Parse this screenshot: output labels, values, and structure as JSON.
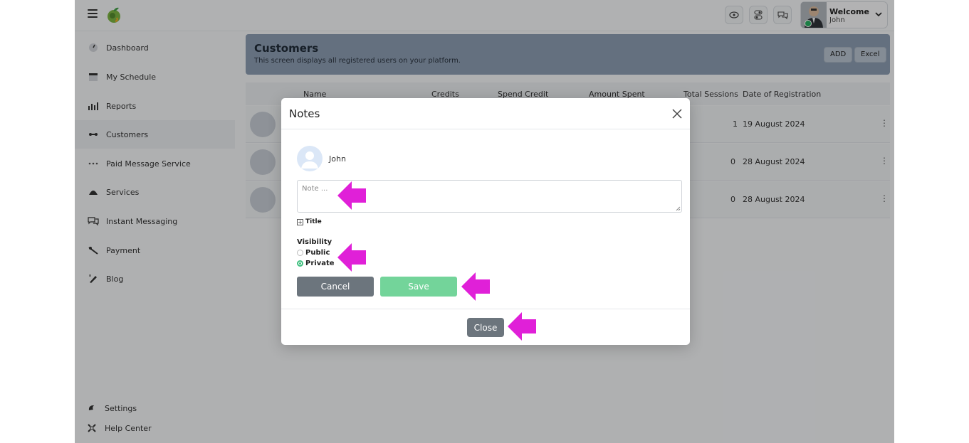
{
  "header": {
    "welcome_label": "Welcome",
    "user_name": "John"
  },
  "sidebar": {
    "items": [
      {
        "label": "Dashboard",
        "icon": "dashboard-icon"
      },
      {
        "label": "My Schedule",
        "icon": "calendar-icon"
      },
      {
        "label": "Reports",
        "icon": "bar-chart-icon"
      },
      {
        "label": "Customers",
        "icon": "customers-icon"
      },
      {
        "label": "Paid Message Service",
        "icon": "dots-icon"
      },
      {
        "label": "Services",
        "icon": "services-icon"
      },
      {
        "label": "Instant Messaging",
        "icon": "chat-icon"
      },
      {
        "label": "Payment",
        "icon": "payment-icon"
      },
      {
        "label": "Blog",
        "icon": "blog-icon"
      }
    ],
    "settings_label": "Settings",
    "help_label": "Help Center"
  },
  "page": {
    "title": "Customers",
    "subtitle": "This screen displays all registered users on your platform.",
    "add_label": "ADD",
    "excel_label": "Excel"
  },
  "table": {
    "columns": [
      "Name",
      "Credits",
      "Spend Credit",
      "Amount Spent",
      "Total Sessions",
      "Date of Registration"
    ],
    "rows": [
      {
        "sessions": "1",
        "date": "19 August 2024"
      },
      {
        "sessions": "0",
        "date": "28 August 2024"
      },
      {
        "sessions": "0",
        "date": "28 August 2024"
      }
    ]
  },
  "modal": {
    "title": "Notes",
    "user_name": "John",
    "note_placeholder": "Note ...",
    "title_toggle": "Title",
    "visibility_label": "Visibility",
    "public_label": "Public",
    "private_label": "Private",
    "selected_visibility": "Private",
    "cancel_label": "Cancel",
    "save_label": "Save",
    "close_label": "Close"
  },
  "colors": {
    "accent_green": "#73d49a",
    "annotation_arrow": "#e020d8",
    "banner": "#8b9cb0"
  }
}
